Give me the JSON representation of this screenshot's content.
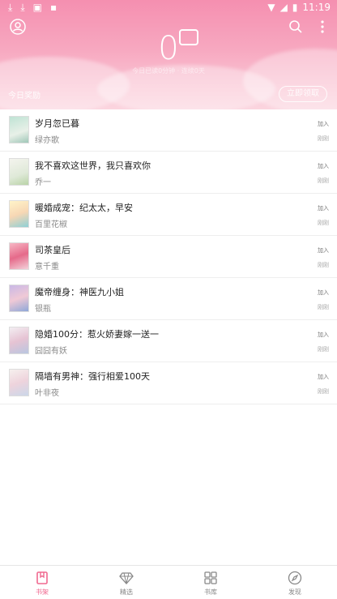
{
  "status_bar": {
    "time": "11:19"
  },
  "header": {
    "count": "0",
    "sub_note": "今日已读0分钟 · 连续0天",
    "reward_label": "今日奖励",
    "reward_button": "立即领取"
  },
  "books": [
    {
      "title": "岁月忽已暮",
      "author": "绿亦歌",
      "join": "加入",
      "date": "刚刚"
    },
    {
      "title": "我不喜欢这世界，我只喜欢你",
      "author": "乔一",
      "join": "加入",
      "date": "刚刚"
    },
    {
      "title": "暖婚成宠：纪太太，早安",
      "author": "百里花椒",
      "join": "加入",
      "date": "刚刚"
    },
    {
      "title": "司茶皇后",
      "author": "意千重",
      "join": "加入",
      "date": "刚刚"
    },
    {
      "title": "魔帝缠身：神医九小姐",
      "author": "银瓶",
      "join": "加入",
      "date": "刚刚"
    },
    {
      "title": "隐婚100分：惹火娇妻嫁一送一",
      "author": "囧囧有妖",
      "join": "加入",
      "date": "刚刚"
    },
    {
      "title": "隔墙有男神：强行相爱100天",
      "author": "叶非夜",
      "join": "加入",
      "date": "刚刚"
    }
  ],
  "nav": [
    {
      "label": "书架",
      "icon": "bookshelf-icon"
    },
    {
      "label": "精选",
      "icon": "diamond-icon"
    },
    {
      "label": "书库",
      "icon": "grid-icon"
    },
    {
      "label": "发现",
      "icon": "compass-icon"
    }
  ],
  "colors": {
    "accent": "#f0688f",
    "header_top": "#f58fb0",
    "header_bottom": "#fbd5df"
  }
}
